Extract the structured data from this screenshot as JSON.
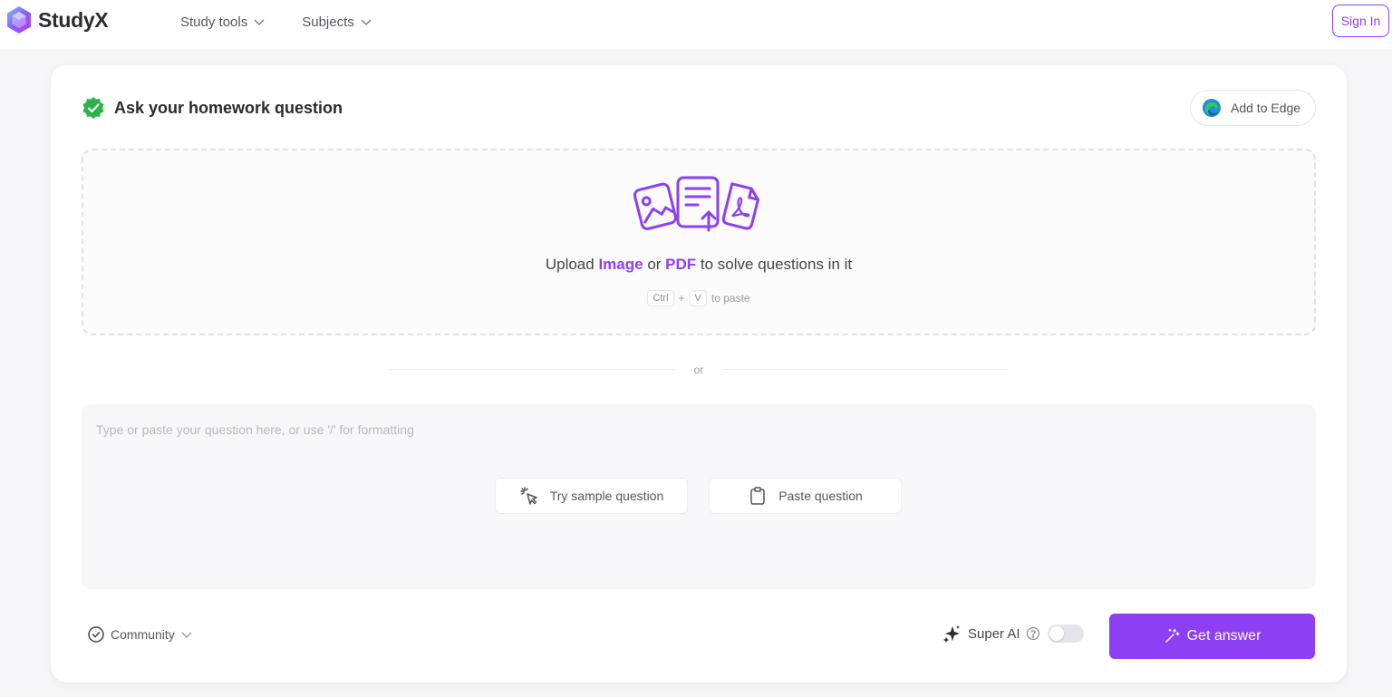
{
  "header": {
    "brand": "StudyX",
    "nav": [
      {
        "label": "Study tools"
      },
      {
        "label": "Subjects"
      }
    ],
    "signin_label": "Sign In"
  },
  "card": {
    "title": "Ask your homework question",
    "edge_button_label": "Add to Edge",
    "upload": {
      "prefix": "Upload ",
      "image_label": "Image",
      "middle": " or ",
      "pdf_label": "PDF",
      "suffix": " to solve questions in it",
      "key1": "Ctrl",
      "plus": "+",
      "key2": "V",
      "paste_hint": "to paste"
    },
    "or_label": "or",
    "question": {
      "placeholder": "Type or paste your question here, or use '/' for formatting",
      "value": "",
      "sample_button": "Try sample question",
      "paste_button": "Paste question"
    },
    "footer": {
      "community_label": "Community",
      "super_ai_label": "Super AI",
      "super_ai_enabled": false,
      "get_answer_label": "Get answer"
    }
  },
  "colors": {
    "accent": "#8d3ff4",
    "check_green": "#2bb34a",
    "edge_blue": "#1b8fd8",
    "edge_green": "#39c46b"
  },
  "icons": [
    "studyx-logo-icon",
    "chevron-down-icon",
    "check-circle-icon",
    "edge-icon",
    "upload-files-icon",
    "magic-cursor-icon",
    "clipboard-icon",
    "spark-icon",
    "help-circle-icon",
    "wand-icon"
  ]
}
